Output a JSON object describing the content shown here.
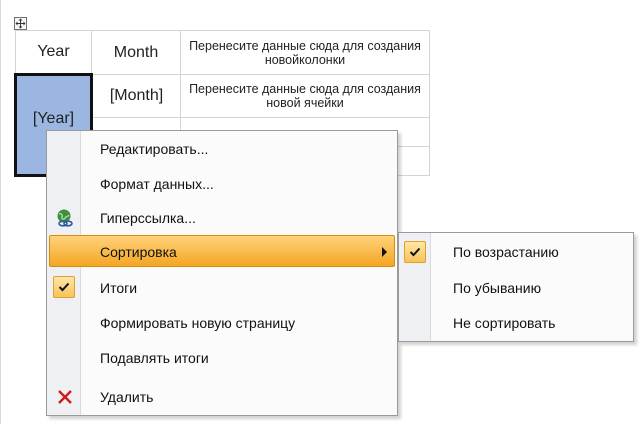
{
  "table": {
    "header": {
      "year": "Year",
      "month": "Month",
      "drop_column_hint": "Перенесите данные сюда для создания новойколонки"
    },
    "row": {
      "year_field": "[Year]",
      "month_field": "[Month]",
      "drop_cell_hint": "Перенесите данные сюда для создания новой ячейки"
    }
  },
  "context_menu": {
    "items": [
      {
        "label": "Редактировать..."
      },
      {
        "label": "Формат данных..."
      },
      {
        "label": "Гиперссылка...",
        "icon": "hyperlink-globe-icon"
      },
      {
        "label": "Сортировка",
        "highlighted": true,
        "has_submenu": true
      },
      {
        "label": "Итоги",
        "checked": true
      },
      {
        "label": "Формировать новую страницу"
      },
      {
        "label": "Подавлять итоги"
      },
      {
        "label": "Удалить",
        "icon": "delete-x-icon"
      }
    ]
  },
  "sort_submenu": {
    "items": [
      {
        "label": "По возрастанию",
        "checked": true
      },
      {
        "label": "По убыванию"
      },
      {
        "label": "Не сортировать"
      }
    ]
  },
  "colors": {
    "highlight": "#f4a623",
    "selected_field": "#9cb6e2",
    "delete": "#d11a1a"
  }
}
